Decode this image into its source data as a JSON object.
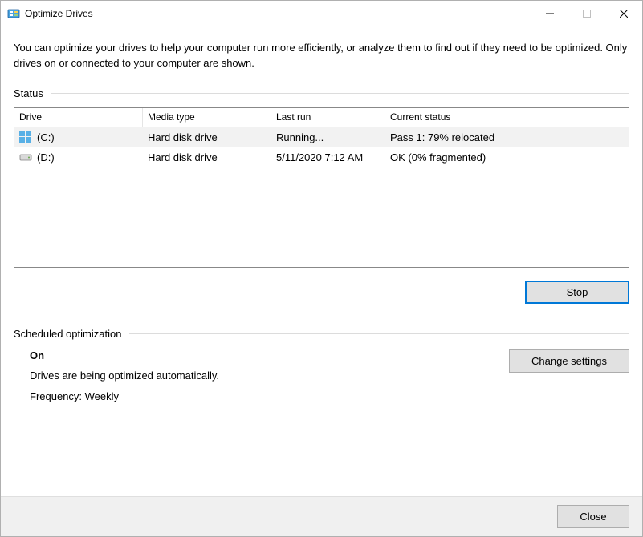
{
  "window": {
    "title": "Optimize Drives"
  },
  "description": "You can optimize your drives to help your computer run more efficiently, or analyze them to find out if they need to be optimized. Only drives on or connected to your computer are shown.",
  "status": {
    "label": "Status",
    "columns": {
      "drive": "Drive",
      "media": "Media type",
      "last": "Last run",
      "current": "Current status"
    },
    "rows": [
      {
        "drive": "(C:)",
        "media": "Hard disk drive",
        "last": "Running...",
        "current": "Pass 1: 79% relocated",
        "selected": true,
        "icon": "system-drive"
      },
      {
        "drive": "(D:)",
        "media": "Hard disk drive",
        "last": "5/11/2020 7:12 AM",
        "current": "OK (0% fragmented)",
        "selected": false,
        "icon": "drive"
      }
    ],
    "stop_button": "Stop"
  },
  "schedule": {
    "label": "Scheduled optimization",
    "on_label": "On",
    "auto_text": "Drives are being optimized automatically.",
    "frequency_text": "Frequency: Weekly",
    "change_button": "Change settings"
  },
  "footer": {
    "close_button": "Close"
  }
}
